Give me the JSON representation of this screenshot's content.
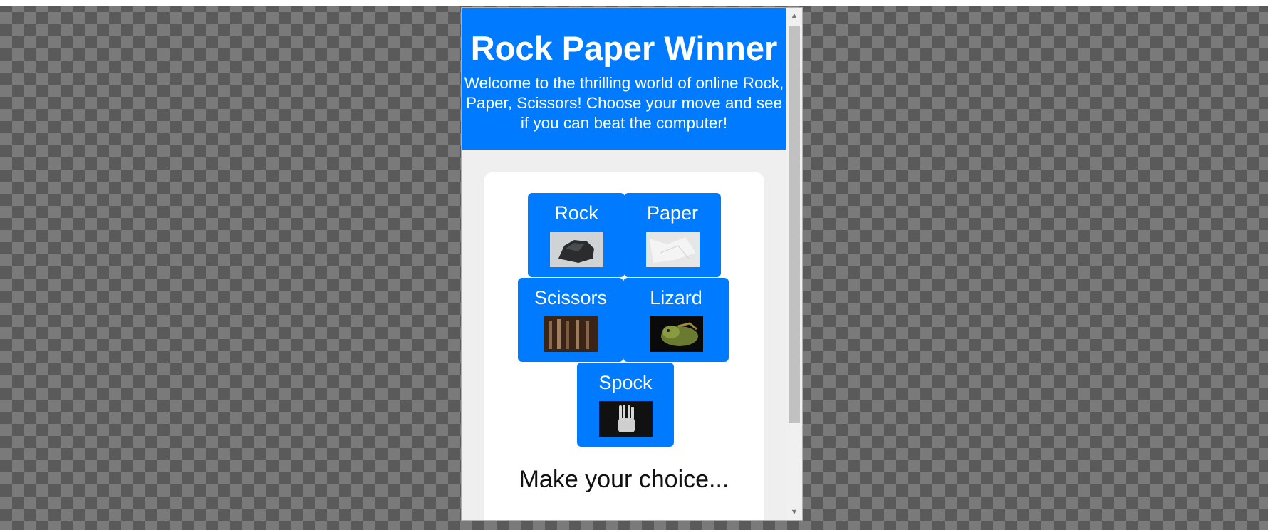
{
  "header": {
    "title": "Rock Paper Winner",
    "subtitle": "Welcome to the thrilling world of online Rock, Paper, Scissors! Choose your move and see if you can beat the computer!",
    "color": "#007bff"
  },
  "choices": [
    {
      "label": "Rock",
      "image": "rock-photo"
    },
    {
      "label": "Paper",
      "image": "paper-photo"
    },
    {
      "label": "Scissors",
      "image": "scissors-photo"
    },
    {
      "label": "Lizard",
      "image": "lizard-photo"
    },
    {
      "label": "Spock",
      "image": "spock-hand-photo"
    }
  ],
  "status": {
    "prompt": "Make your choice..."
  }
}
